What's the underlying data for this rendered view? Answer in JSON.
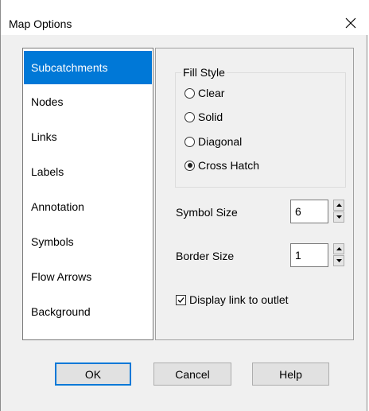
{
  "window": {
    "title": "Map Options"
  },
  "sidebar": {
    "items": [
      {
        "label": "Subcatchments",
        "selected": true
      },
      {
        "label": "Nodes"
      },
      {
        "label": "Links"
      },
      {
        "label": "Labels"
      },
      {
        "label": "Annotation"
      },
      {
        "label": "Symbols"
      },
      {
        "label": "Flow Arrows"
      },
      {
        "label": "Background"
      }
    ]
  },
  "fill_style": {
    "legend": "Fill Style",
    "options": [
      {
        "label": "Clear",
        "checked": false
      },
      {
        "label": "Solid",
        "checked": false
      },
      {
        "label": "Diagonal",
        "checked": false
      },
      {
        "label": "Cross Hatch",
        "checked": true
      }
    ]
  },
  "symbol_size": {
    "label": "Symbol Size",
    "value": "6"
  },
  "border_size": {
    "label": "Border Size",
    "value": "1"
  },
  "display_link": {
    "label": "Display link to outlet",
    "checked": true
  },
  "buttons": {
    "ok": "OK",
    "cancel": "Cancel",
    "help": "Help"
  },
  "colors": {
    "selection": "#0078d7",
    "dialog_bg": "#f0f0f0"
  },
  "icons": {
    "close": "close-icon",
    "spin_up": "spin-up-arrow-icon",
    "spin_down": "spin-down-arrow-icon",
    "check": "checkmark-icon"
  }
}
